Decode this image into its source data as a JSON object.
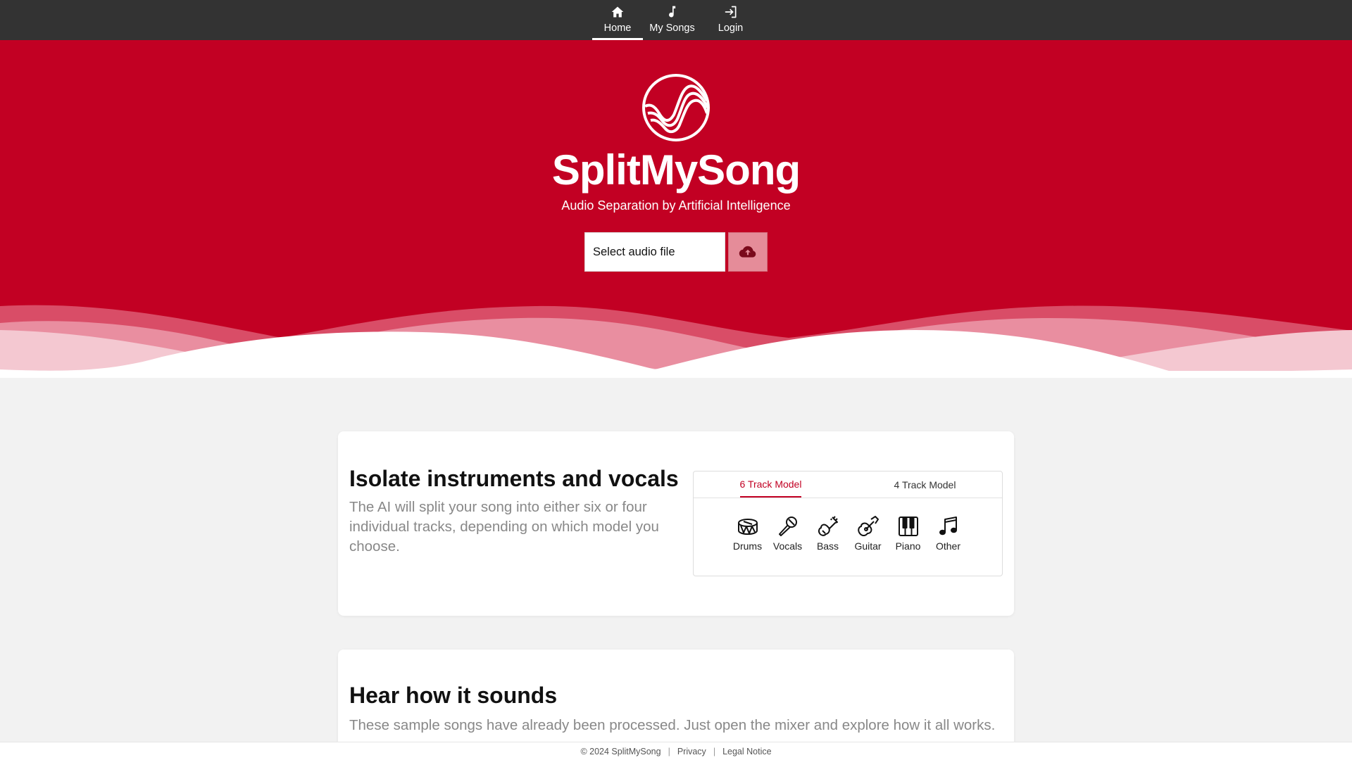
{
  "nav": {
    "items": [
      {
        "label": "Home",
        "icon": "home-icon",
        "active": true
      },
      {
        "label": "My Songs",
        "icon": "music-note-icon",
        "active": false
      },
      {
        "label": "Login",
        "icon": "login-icon",
        "active": false
      }
    ]
  },
  "hero": {
    "title": "SplitMySong",
    "subtitle": "Audio Separation by Artificial Intelligence",
    "file_select_label": "Select audio file",
    "upload_icon": "cloud-upload-icon",
    "background_color": "#c20023"
  },
  "features": {
    "heading": "Isolate instruments and vocals",
    "description": "The AI will split your song into either six or four individual tracks, depending on which model you choose.",
    "tabs": [
      {
        "label": "6 Track Model",
        "active": true
      },
      {
        "label": "4 Track Model",
        "active": false
      }
    ],
    "instruments": [
      {
        "label": "Drums",
        "icon": "drum-icon"
      },
      {
        "label": "Vocals",
        "icon": "microphone-icon"
      },
      {
        "label": "Bass",
        "icon": "bass-icon"
      },
      {
        "label": "Guitar",
        "icon": "guitar-icon"
      },
      {
        "label": "Piano",
        "icon": "piano-icon"
      },
      {
        "label": "Other",
        "icon": "music-notes-icon"
      }
    ]
  },
  "samples": {
    "heading": "Hear how it sounds",
    "description": "These sample songs have already been processed. Just open the mixer and explore how it all works."
  },
  "footer": {
    "copyright": "© 2024 SplitMySong",
    "privacy": "Privacy",
    "legal": "Legal Notice"
  }
}
